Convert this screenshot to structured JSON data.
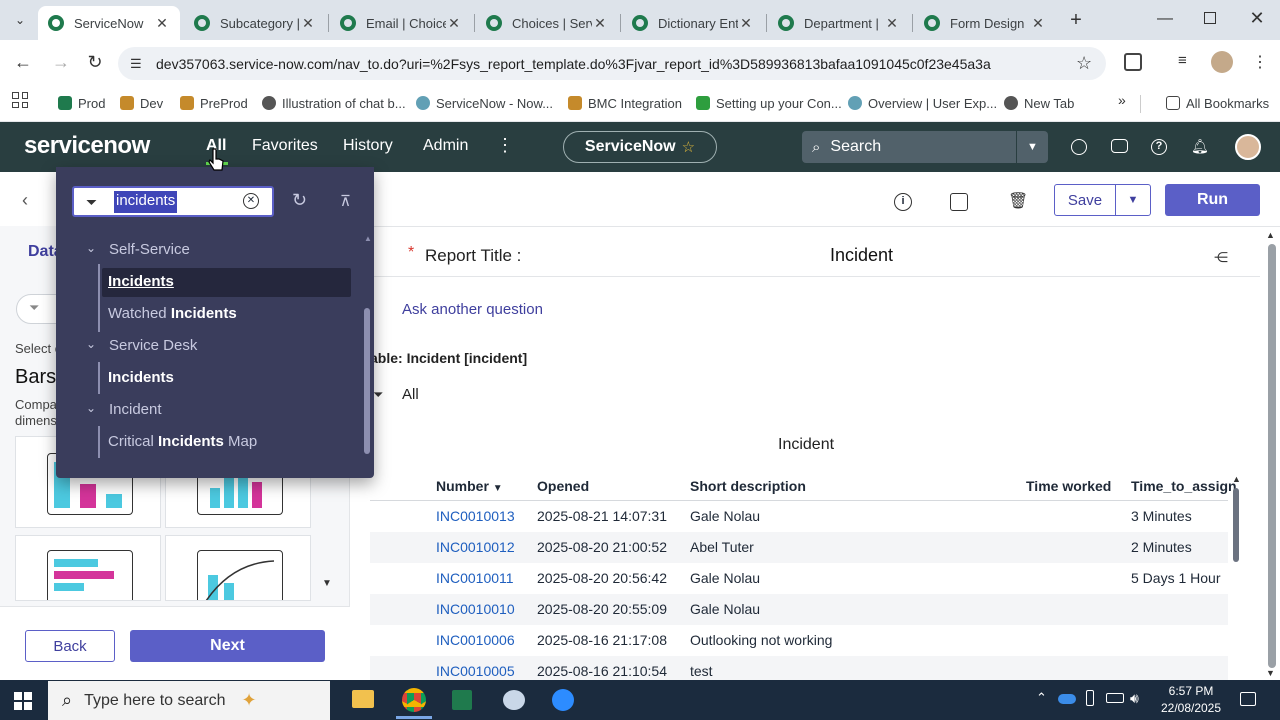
{
  "browser": {
    "tabs": [
      {
        "label": "ServiceNow",
        "active": true
      },
      {
        "label": "Subcategory |",
        "active": false
      },
      {
        "label": "Email | Choice",
        "active": false
      },
      {
        "label": "Choices | Serv",
        "active": false
      },
      {
        "label": "Dictionary Ent",
        "active": false
      },
      {
        "label": "Department |",
        "active": false
      },
      {
        "label": "Form Design",
        "active": false
      }
    ],
    "url": "dev357063.service-now.com/nav_to.do?uri=%2Fsys_report_template.do%3Fjvar_report_id%3D589936813bafaa1091045c0f23e45a3a",
    "bookmarks": [
      {
        "label": "Prod",
        "color": "#1f7a4d"
      },
      {
        "label": "Dev",
        "color": "#c58a2b"
      },
      {
        "label": "PreProd",
        "color": "#c58a2b"
      },
      {
        "label": "Illustration of chat b...",
        "color": "#555555"
      },
      {
        "label": "ServiceNow - Now...",
        "color": "#62a0b5"
      },
      {
        "label": "BMC Integration",
        "color": "#c58a2b"
      },
      {
        "label": "Setting up your Con...",
        "color": "#2e9e3e"
      },
      {
        "label": "Overview | User Exp...",
        "color": "#62a0b5"
      },
      {
        "label": "New Tab",
        "color": "#555555"
      }
    ],
    "all_bookmarks": "All Bookmarks"
  },
  "sn_header": {
    "logo": "servicenow",
    "nav": [
      "All",
      "Favorites",
      "History",
      "Admin"
    ],
    "instance": "ServiceNow",
    "search_placeholder": "Search"
  },
  "report": {
    "title_label": "Report Title :",
    "title_value": "Incident",
    "save_label": "Save",
    "run_label": "Run",
    "ask_label": "Ask another question",
    "table_label": "able: Incident [incident]",
    "filter_label": "All",
    "left_tab": "Data",
    "select_label": "Select c",
    "bars_label": "Bars",
    "compare_label": "Compare",
    "dimension_label": "dimensi",
    "back_label": "Back",
    "next_label": "Next",
    "list_title": "Incident",
    "columns": [
      "Number",
      "Opened",
      "Short description",
      "Time worked",
      "Time_to_assign"
    ],
    "rows": [
      {
        "number": "INC0010013",
        "opened": "2025-08-21 14:07:31",
        "desc": "Gale Nolau",
        "worked": "",
        "assign": "3 Minutes"
      },
      {
        "number": "INC0010012",
        "opened": "2025-08-20 21:00:52",
        "desc": "Abel Tuter",
        "worked": "",
        "assign": "2 Minutes"
      },
      {
        "number": "INC0010011",
        "opened": "2025-08-20 20:56:42",
        "desc": "Gale Nolau",
        "worked": "",
        "assign": "5 Days 1 Hour"
      },
      {
        "number": "INC0010010",
        "opened": "2025-08-20 20:55:09",
        "desc": "Gale Nolau",
        "worked": "",
        "assign": ""
      },
      {
        "number": "INC0010006",
        "opened": "2025-08-16 21:17:08",
        "desc": "Outlooking not working",
        "worked": "",
        "assign": ""
      },
      {
        "number": "INC0010005",
        "opened": "2025-08-16 21:10:54",
        "desc": "test",
        "worked": "",
        "assign": ""
      }
    ]
  },
  "all_menu": {
    "filter_value": "incidents",
    "groups": [
      {
        "label": "Self-Service",
        "items": [
          {
            "pre": "",
            "bold": "Incidents",
            "post": "",
            "selected": true
          },
          {
            "pre": "Watched ",
            "bold": "Incidents",
            "post": "",
            "selected": false
          }
        ]
      },
      {
        "label": "Service Desk",
        "items": [
          {
            "pre": "",
            "bold": "Incidents",
            "post": "",
            "selected": false
          }
        ]
      },
      {
        "label": "Incident",
        "items": [
          {
            "pre": "Critical ",
            "bold": "Incidents",
            "post": " Map",
            "selected": false
          }
        ]
      }
    ]
  },
  "taskbar": {
    "search_placeholder": "Type here to search",
    "time": "6:57 PM",
    "date": "22/08/2025"
  },
  "colors": {
    "sn_header": "#293e40",
    "accent": "#5b5fc7",
    "menu_bg": "#3a3d5c",
    "link": "#1f5fbf",
    "bar_cyan": "#4cc9e0",
    "bar_magenta": "#d4349a"
  }
}
